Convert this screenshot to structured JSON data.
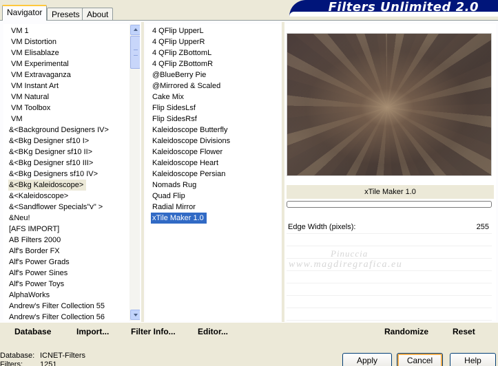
{
  "tabs": [
    {
      "label": "Navigator",
      "active": true
    },
    {
      "label": "Presets",
      "active": false
    },
    {
      "label": "About",
      "active": false
    }
  ],
  "banner": {
    "title": "Filters Unlimited 2.0"
  },
  "categories": [
    "VM 1",
    "VM Distortion",
    "VM Elisablaze",
    "VM Experimental",
    "VM Extravaganza",
    "VM Instant Art",
    "VM Natural",
    "VM Toolbox",
    "VM",
    "&<Background Designers IV>",
    "&<Bkg Designer sf10 I>",
    "&<BKg Designer sf10 II>",
    "&<Bkg Designer sf10 III>",
    "&<Bkg Designers sf10 IV>",
    "&<Bkg Kaleidoscope>",
    "&<Kaleidoscope>",
    "&<Sandflower Specials\"v\" >",
    "&Neu!",
    "[AFS IMPORT]",
    "AB Filters 2000",
    "Alf's Border FX",
    "Alf's Power Grads",
    "Alf's Power Sines",
    "Alf's Power Toys",
    "AlphaWorks",
    "Andrew's Filter Collection 55",
    "Andrew's Filter Collection 56"
  ],
  "selected_category_index": 14,
  "filters": [
    "4 QFlip UpperL",
    "4 QFlip UpperR",
    "4 QFlip ZBottomL",
    "4 QFlip ZBottomR",
    "@BlueBerry Pie",
    "@Mirrored & Scaled",
    "Cake Mix",
    "Flip SidesLsf",
    "Flip SidesRsf",
    "Kaleidoscope Butterfly",
    "Kaleidoscope Divisions",
    "Kaleidoscope Flower",
    "Kaleidoscope Heart",
    "Kaleidoscope Persian",
    "Nomads Rug",
    "Quad Flip",
    "Radial Mirror",
    "xTile Maker 1.0"
  ],
  "selected_filter_index": 17,
  "preview": {
    "filter_name": "xTile Maker 1.0",
    "progress": 0
  },
  "params": [
    {
      "label": "Edge Width (pixels):",
      "value": "255"
    }
  ],
  "watermark": {
    "line1": "Pinuccia",
    "line2": "www.magdiregrafica.eu"
  },
  "links": {
    "database": "Database",
    "import": "Import...",
    "filter_info": "Filter Info...",
    "editor": "Editor...",
    "randomize": "Randomize",
    "reset": "Reset"
  },
  "status": {
    "database_label": "Database:",
    "database_value": "ICNET-Filters",
    "filters_label": "Filters:",
    "filters_value": "1251"
  },
  "buttons": {
    "apply": "Apply",
    "cancel": "Cancel",
    "help": "Help"
  }
}
